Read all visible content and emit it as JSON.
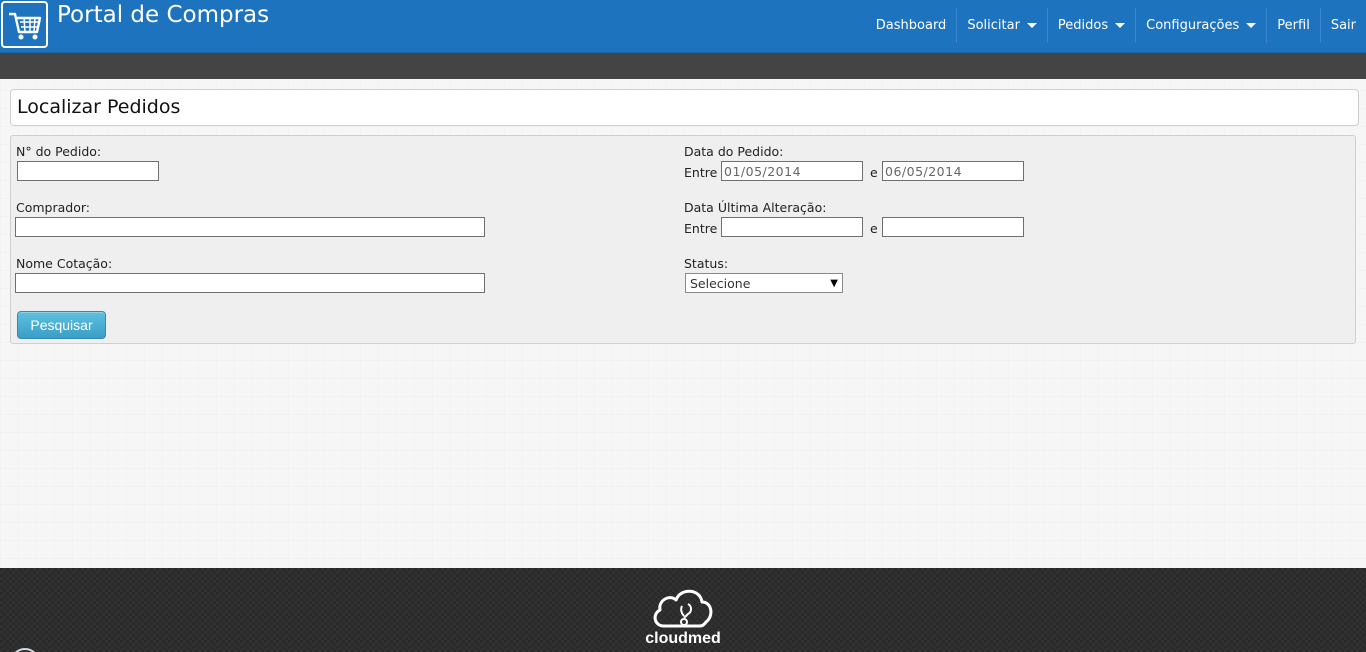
{
  "header": {
    "title": "Portal de Compras",
    "logo_icon": "shopping-cart-icon",
    "colors": {
      "primary": "#1e73be",
      "subbar": "#444444"
    },
    "nav": [
      {
        "label": "Dashboard",
        "has_dropdown": false
      },
      {
        "label": "Solicitar",
        "has_dropdown": true
      },
      {
        "label": "Pedidos",
        "has_dropdown": true
      },
      {
        "label": "Configurações",
        "has_dropdown": true
      },
      {
        "label": "Perfil",
        "has_dropdown": false
      },
      {
        "label": "Sair",
        "has_dropdown": false
      }
    ]
  },
  "page": {
    "title": "Localizar Pedidos"
  },
  "form": {
    "numero_pedido": {
      "label": "N° do Pedido:",
      "value": ""
    },
    "comprador": {
      "label": "Comprador:",
      "value": ""
    },
    "nome_cotacao": {
      "label": "Nome Cotação:",
      "value": ""
    },
    "data_pedido": {
      "label": "Data do Pedido:",
      "between_label": "Entre",
      "and_label": "e",
      "from": "01/05/2014",
      "to": "06/05/2014"
    },
    "data_alteracao": {
      "label": "Data Última Alteração:",
      "between_label": "Entre",
      "and_label": "e",
      "from": "",
      "to": ""
    },
    "status": {
      "label": "Status:",
      "selected": "Selecione"
    },
    "search_button": "Pesquisar",
    "button_color": "#4cb1d6"
  },
  "footer": {
    "brand": "cloudmed",
    "logo_icon": "cloud-stethoscope-icon"
  }
}
